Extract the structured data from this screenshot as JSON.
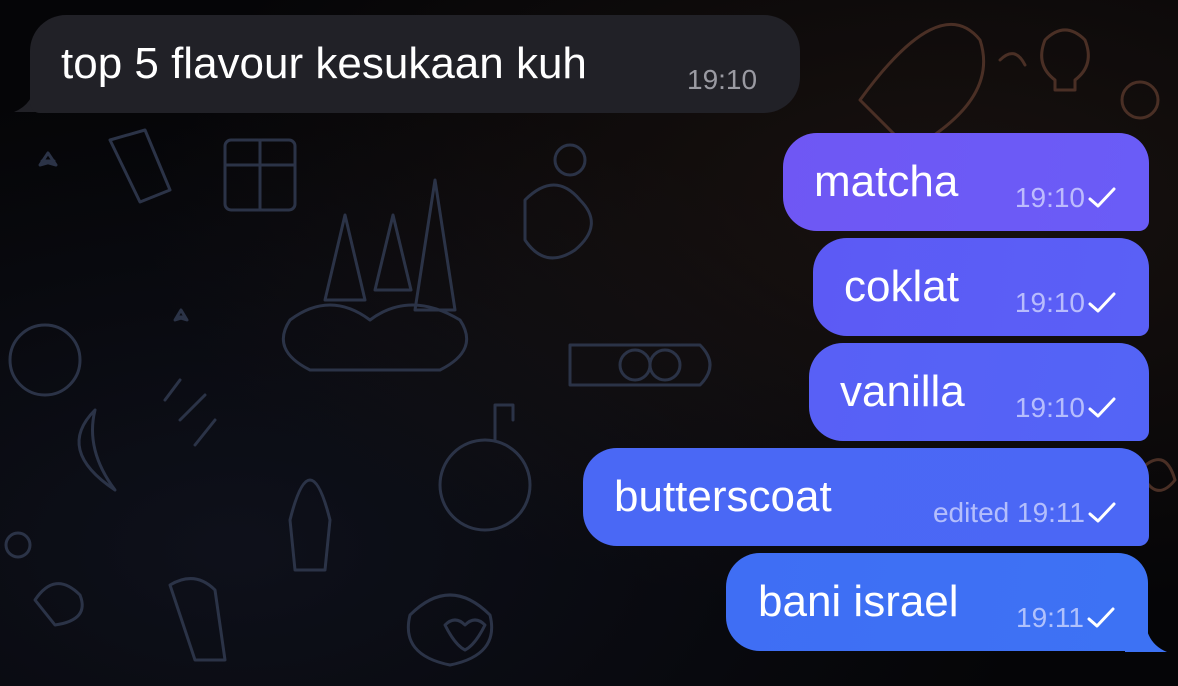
{
  "incoming": {
    "text": "top 5 flavour kesukaan kuh",
    "time": "19:10"
  },
  "outgoing": [
    {
      "text": "matcha",
      "meta": "19:10"
    },
    {
      "text": "coklat",
      "meta": "19:10"
    },
    {
      "text": "vanilla",
      "meta": "19:10"
    },
    {
      "text": "butterscoat",
      "meta": "edited 19:11"
    },
    {
      "text": "bani israel",
      "meta": "19:11"
    }
  ],
  "colors": {
    "incoming_bubble": "#212127",
    "outgoing_top": "#6f57f4",
    "outgoing_bottom": "#3d72f4",
    "background": "#050507"
  },
  "icons": {
    "read_status": "single-check-icon"
  }
}
